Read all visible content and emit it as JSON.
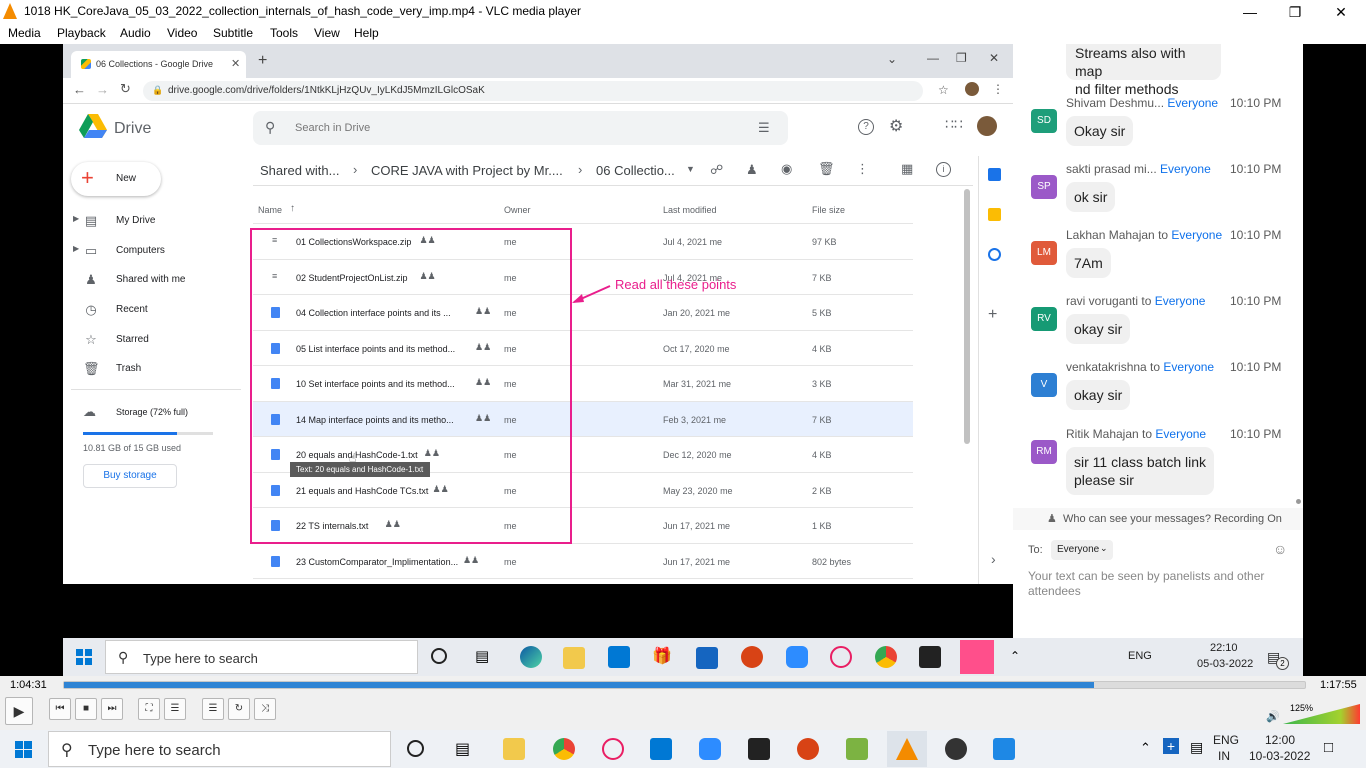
{
  "vlc": {
    "title": "1018 HK_CoreJava_05_03_2022_collection_internals_of_hash_code_very_imp.mp4 - VLC media player",
    "menu": [
      "Media",
      "Playback",
      "Audio",
      "Video",
      "Subtitle",
      "Tools",
      "View",
      "Help"
    ],
    "elapsed": "1:04:31",
    "total": "1:17:55",
    "progress": 0.83,
    "volume_pct": "125%"
  },
  "browser": {
    "tab_title": "06 Collections - Google Drive",
    "url": "drive.google.com/drive/folders/1NtkKLjHzQUv_IyLKdJ5MmzILGlcOSaK"
  },
  "drive": {
    "logo_text": "Drive",
    "search_placeholder": "Search in Drive",
    "new_label": "New",
    "breadcrumb": [
      "Shared with...",
      "CORE JAVA with Project by Mr....",
      "06 Collectio..."
    ],
    "sidebar": [
      {
        "label": "My Drive",
        "icon": "drive-icon"
      },
      {
        "label": "Computers",
        "icon": "computer-icon"
      },
      {
        "label": "Shared with me",
        "icon": "people-icon"
      },
      {
        "label": "Recent",
        "icon": "clock-icon"
      },
      {
        "label": "Starred",
        "icon": "star-icon"
      },
      {
        "label": "Trash",
        "icon": "trash-icon"
      }
    ],
    "storage_label": "Storage (72% full)",
    "storage_fraction": 0.72,
    "storage_used": "10.81 GB of 15 GB used",
    "buy_storage": "Buy storage",
    "columns": {
      "name": "Name",
      "owner": "Owner",
      "modified": "Last modified",
      "size": "File size"
    },
    "files": [
      {
        "name": "01 CollectionsWorkspace.zip",
        "owner": "me",
        "modified": "Jul 4, 2021",
        "by": "me",
        "size": "97 KB",
        "type": "zip"
      },
      {
        "name": "02 StudentProjectOnList.zip",
        "owner": "me",
        "modified": "Jul 4, 2021",
        "by": "me",
        "size": "7 KB",
        "type": "zip"
      },
      {
        "name": "04 Collection interface points and its ...",
        "owner": "me",
        "modified": "Jan 20, 2021",
        "by": "me",
        "size": "5 KB",
        "type": "doc"
      },
      {
        "name": "05 List interface points and its method...",
        "owner": "me",
        "modified": "Oct 17, 2020",
        "by": "me",
        "size": "4 KB",
        "type": "doc"
      },
      {
        "name": "10 Set interface points and its method...",
        "owner": "me",
        "modified": "Mar 31, 2021",
        "by": "me",
        "size": "3 KB",
        "type": "doc"
      },
      {
        "name": "14 Map interface points and its metho...",
        "owner": "me",
        "modified": "Feb 3, 2021",
        "by": "me",
        "size": "7 KB",
        "type": "doc"
      },
      {
        "name": "20 equals and HashCode-1.txt",
        "owner": "me",
        "modified": "Dec 12, 2020",
        "by": "me",
        "size": "4 KB",
        "type": "doc"
      },
      {
        "name": "21 equals and HashCode TCs.txt",
        "owner": "me",
        "modified": "May 23, 2020",
        "by": "me",
        "size": "2 KB",
        "type": "doc"
      },
      {
        "name": "22 TS internals.txt",
        "owner": "me",
        "modified": "Jun 17, 2021",
        "by": "me",
        "size": "1 KB",
        "type": "doc"
      },
      {
        "name": "23 CustomComparator_Implimentation...",
        "owner": "me",
        "modified": "Jun 17, 2021",
        "by": "me",
        "size": "802 bytes",
        "type": "doc"
      }
    ],
    "tooltip": "Text: 20 equals and HashCode-1.txt",
    "annotation": "Read all these points",
    "accent": "#e91e8c"
  },
  "chat": {
    "top_snippet": [
      "Streams also with map",
      "nd filter methods"
    ],
    "messages": [
      {
        "initials": "SD",
        "sender": "Shivam Deshmu...",
        "to": "Everyone",
        "time": "10:10 PM",
        "text": [
          "Okay sir"
        ],
        "color": "#1e9e7a"
      },
      {
        "initials": "SP",
        "sender": "sakti prasad mi...",
        "to": "Everyone",
        "time": "10:10 PM",
        "text": [
          "ok sir"
        ],
        "color": "#9b59c8"
      },
      {
        "initials": "LM",
        "sender": "Lakhan Mahajan to",
        "to": "Everyone",
        "time": "10:10 PM",
        "text": [
          "7Am"
        ],
        "color": "#e05a3a"
      },
      {
        "initials": "RV",
        "sender": "ravi voruganti to",
        "to": "Everyone",
        "time": "10:10 PM",
        "text": [
          "okay sir"
        ],
        "color": "#169a74"
      },
      {
        "initials": "V",
        "sender": "venkatakrishna to",
        "to": "Everyone",
        "time": "10:10 PM",
        "text": [
          "okay sir"
        ],
        "color": "#2d7fd3"
      },
      {
        "initials": "RM",
        "sender": "Ritik Mahajan to",
        "to": "Everyone",
        "time": "10:10 PM",
        "text": [
          "sir 11 class batch link",
          "please sir"
        ],
        "color": "#9b59c8"
      }
    ],
    "privacy_note": "Who can see your messages? Recording On",
    "to_label": "To:",
    "to_value": "Everyone",
    "placeholder": "Your text can be seen by panelists and other attendees"
  },
  "inner_taskbar": {
    "search": "Type here to search",
    "tray_lang": "ENG",
    "time": "22:10",
    "date": "05-03-2022",
    "notif_count": "2"
  },
  "outer_taskbar": {
    "search": "Type here to search",
    "lang1": "ENG",
    "lang2": "IN",
    "time": "12:00",
    "date": "10-03-2022"
  }
}
